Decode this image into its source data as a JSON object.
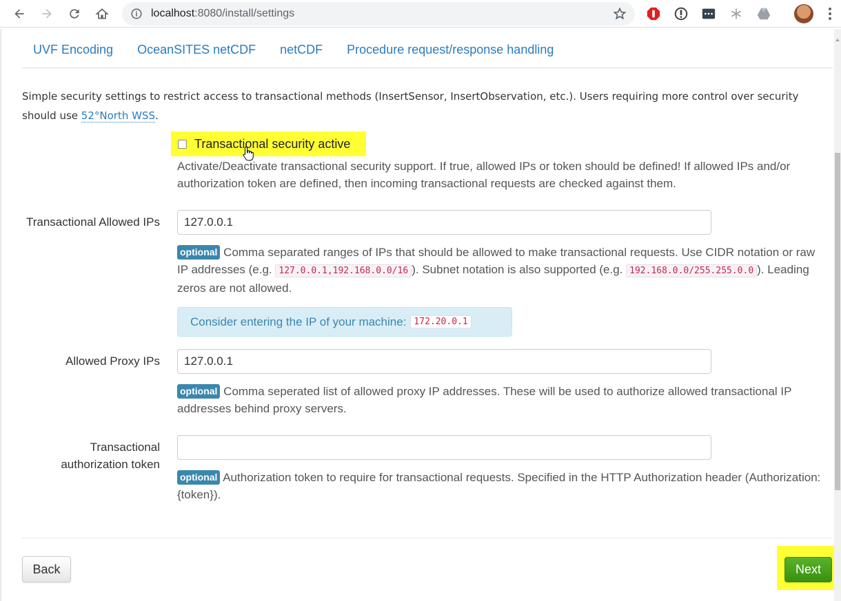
{
  "browser": {
    "url_host": "localhost",
    "url_path": ":8080/install/settings"
  },
  "tabs": [
    {
      "label": "UVF Encoding"
    },
    {
      "label": "OceanSITES netCDF"
    },
    {
      "label": "netCDF"
    },
    {
      "label": "Procedure request/response handling"
    }
  ],
  "intro": {
    "text_before": "Simple security settings to restrict access to transactional methods (InsertSensor, InsertObservation, etc.). Users requiring more control over security should use ",
    "link": "52°North WSS",
    "text_after": "."
  },
  "transactional_security": {
    "label": "Transactional security active",
    "checked": false,
    "help": "Activate/Deactivate transactional security support. If true, allowed IPs or token should be defined! If allowed IPs and/or authorization token are defined, then incoming transactional requests are checked against them."
  },
  "allowed_ips": {
    "label": "Transactional Allowed IPs",
    "value": "127.0.0.1",
    "badge": "optional",
    "help_1": " Comma separated ranges of IPs that should be allowed to make transactional requests. Use CIDR notation or raw IP addresses (e.g. ",
    "code_1": "127.0.0.1,192.168.0.0/16",
    "help_2": "). Subnet notation is also supported (e.g. ",
    "code_2": "192.168.0.0/255.255.0.0",
    "help_3": "). Leading zeros are not allowed.",
    "alert_text": "Consider entering the IP of your machine:",
    "alert_ip": "172.20.0.1"
  },
  "proxy_ips": {
    "label": "Allowed Proxy IPs",
    "value": "127.0.0.1",
    "badge": "optional",
    "help": " Comma seperated list of allowed proxy IP addresses. These will be used to authorize allowed transactional IP addresses behind proxy servers."
  },
  "auth_token": {
    "label_line1": "Transactional",
    "label_line2": "authorization token",
    "value": "",
    "badge": "optional",
    "help": " Authorization token to require for transactional requests. Specified in the HTTP Authorization header (Authorization: {token})."
  },
  "buttons": {
    "back": "Back",
    "next": "Next"
  },
  "colors": {
    "link": "#2a7bbd",
    "badge": "#3a87ad",
    "highlight": "#ffff33",
    "next_button": "#38910f"
  }
}
